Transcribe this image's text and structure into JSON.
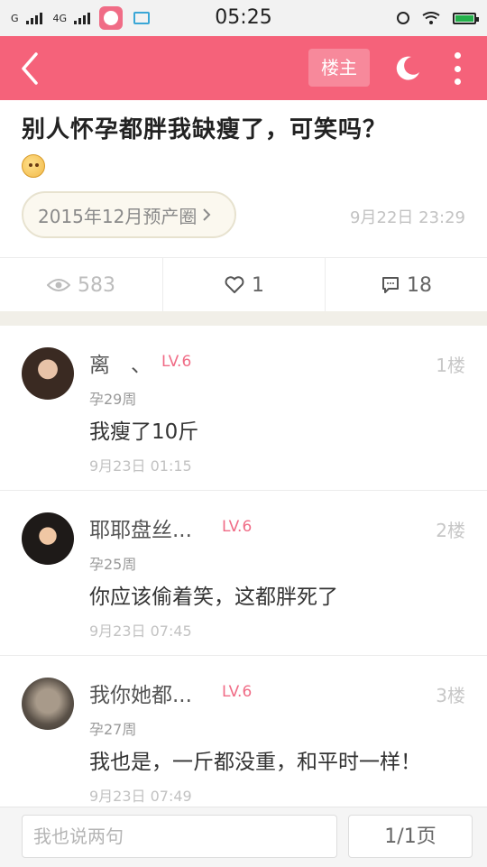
{
  "status_bar": {
    "carrier_left": "G",
    "network_label": "4G",
    "time": "05:25"
  },
  "app_bar": {
    "op_button": "楼主",
    "icons": [
      "back-arrow-icon",
      "moon-icon",
      "more-vertical-icon"
    ]
  },
  "post": {
    "title": "别人怀孕都胖我缺瘦了，可笑吗？",
    "circle": "2015年12月预产圈",
    "time": "9月22日 23:29",
    "stats": {
      "views": "583",
      "likes": "1",
      "comments": "18"
    }
  },
  "replies": [
    {
      "name": "离　、",
      "level": "LV.6",
      "floor": "1楼",
      "week": "孕29周",
      "text": "我瘦了10斤",
      "time": "9月23日 01:15"
    },
    {
      "name": "耶耶盘丝...",
      "level": "LV.6",
      "floor": "2楼",
      "week": "孕25周",
      "text": "你应该偷着笑，这都胖死了",
      "time": "9月23日 07:45"
    },
    {
      "name": "我你她都...",
      "level": "LV.6",
      "floor": "3楼",
      "week": "孕27周",
      "text": "我也是，一斤都没重，和平时一样！",
      "time": "9月23日 07:49"
    }
  ],
  "bottom_bar": {
    "input_placeholder": "我也说两句",
    "page_indicator": "1/1页"
  },
  "colors": {
    "brand": "#f5627a",
    "level": "#f06c86"
  }
}
